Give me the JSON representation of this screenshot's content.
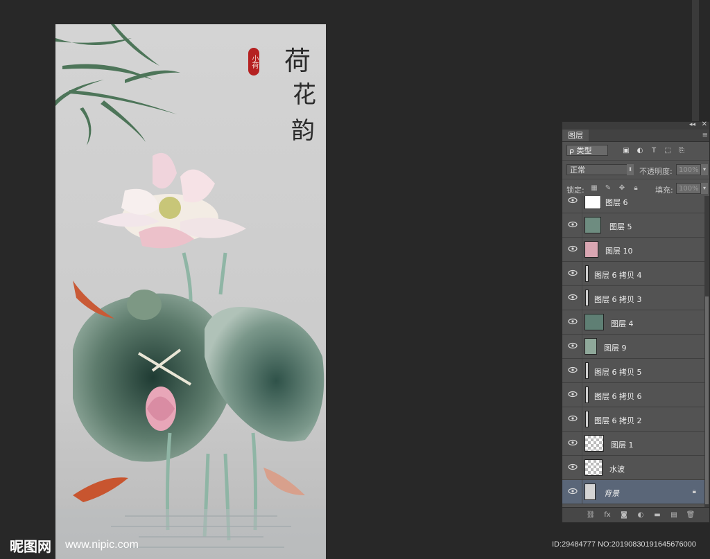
{
  "artwork": {
    "title_chars": [
      "荷",
      "花",
      "韵"
    ],
    "seal_text": "小荷"
  },
  "watermark": {
    "logo": "昵图网",
    "url": "www.nipic.com",
    "id_line": "ID:29484777 NO:20190830191645676000"
  },
  "layers_panel": {
    "tab_label": "图层",
    "filter_label": "ρ 类型",
    "blend_mode": "正常",
    "opacity_label": "不透明度:",
    "opacity_value": "100%",
    "lock_label": "锁定:",
    "fill_label": "填充:",
    "fill_value": "100%",
    "layers": [
      {
        "name": "图层 6",
        "selected": false,
        "locked": false
      },
      {
        "name": "图层 5",
        "selected": false,
        "locked": false
      },
      {
        "name": "图层 10",
        "selected": false,
        "locked": false
      },
      {
        "name": "图层 6 拷贝 4",
        "selected": false,
        "locked": false
      },
      {
        "name": "图层 6 拷贝 3",
        "selected": false,
        "locked": false
      },
      {
        "name": "图层 4",
        "selected": false,
        "locked": false
      },
      {
        "name": "图层 9",
        "selected": false,
        "locked": false
      },
      {
        "name": "图层 6 拷贝 5",
        "selected": false,
        "locked": false
      },
      {
        "name": "图层 6 拷贝 6",
        "selected": false,
        "locked": false
      },
      {
        "name": "图层 6 拷贝 2",
        "selected": false,
        "locked": false
      },
      {
        "name": "图层 1",
        "selected": false,
        "locked": false
      },
      {
        "name": "水波",
        "selected": false,
        "locked": false
      },
      {
        "name": "背景",
        "selected": true,
        "locked": true
      }
    ]
  },
  "colors": {
    "workspace_bg": "#282828",
    "panel_bg": "#535353",
    "selected_layer": "#5a6678"
  }
}
